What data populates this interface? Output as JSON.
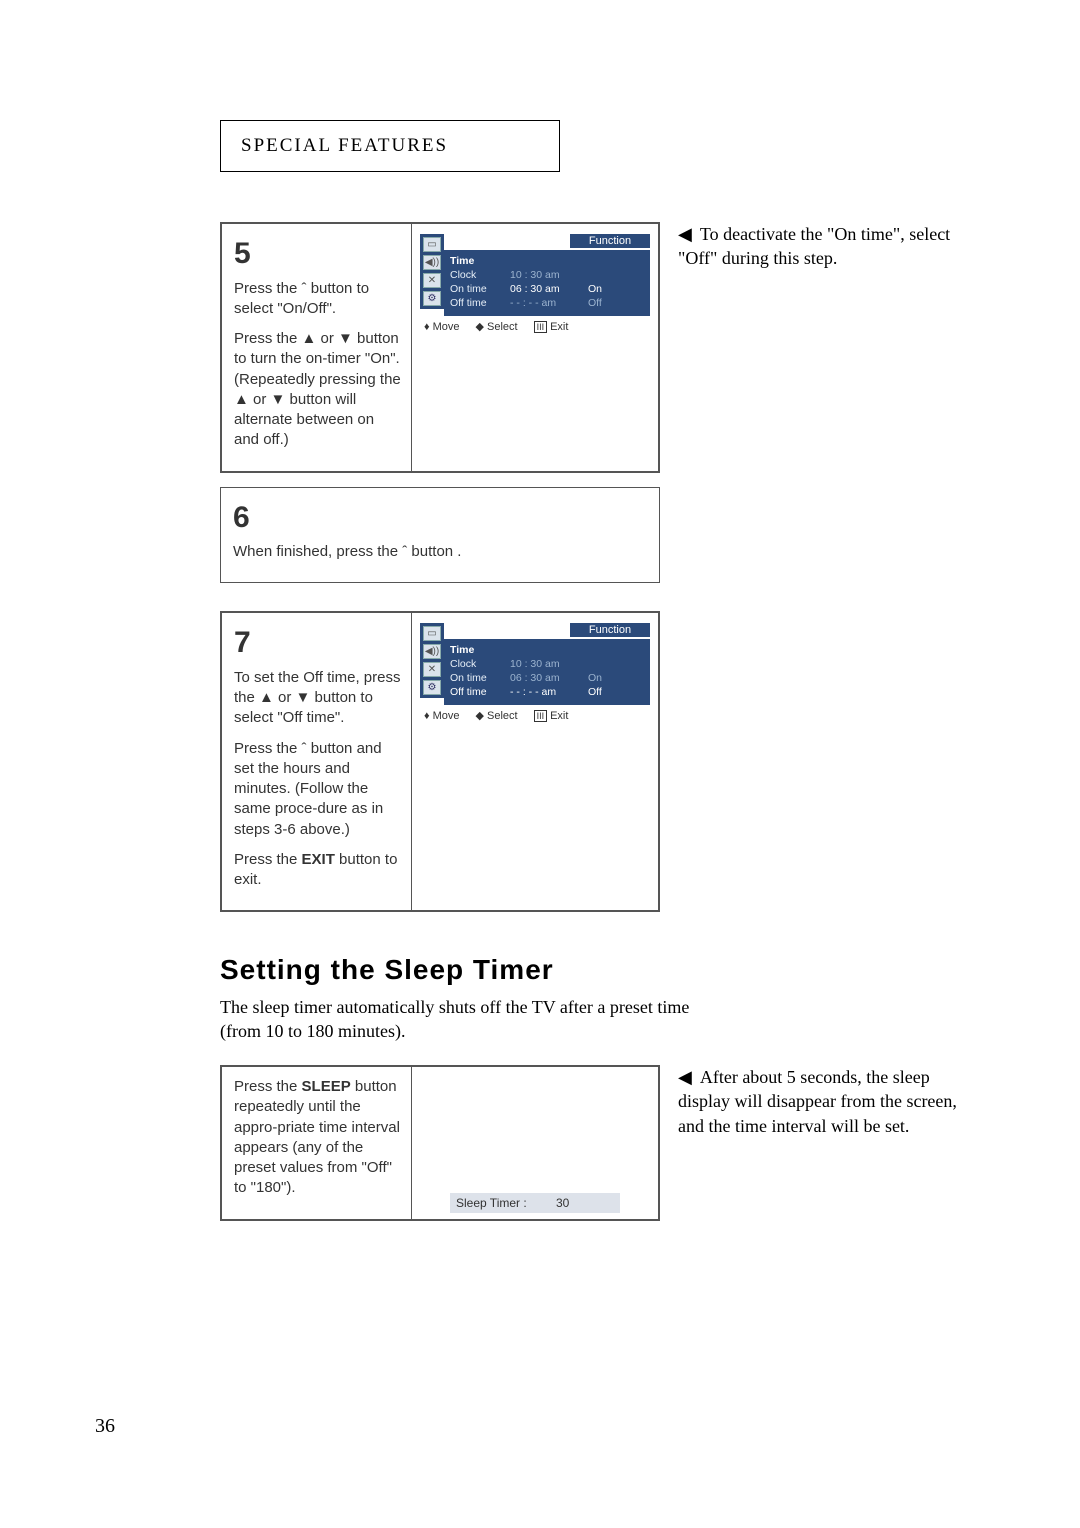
{
  "header": {
    "title": "SPECIAL FEATURES"
  },
  "note5": {
    "text": "To deactivate the \"On time\", select \"Off\" during this step."
  },
  "noteSleep": {
    "text": "After about 5 seconds, the sleep display will disappear from the screen, and the time interval will be set."
  },
  "step5": {
    "num": "5",
    "p1a": "Press the ",
    "p1b": " button to select \"On/Off\".",
    "p2a": "Press the ▲ or ▼ button to turn the on-timer \"On\". (Repeatedly pressing the ▲ or ▼ button will alternate between on and off.)"
  },
  "step6": {
    "num": "6",
    "p1": "When finished, press the ˆ button ."
  },
  "step7": {
    "num": "7",
    "p1": "To set the Off time, press the ▲ or ▼ button to select \"Off time\".",
    "p2": "Press the ˆ button and set the hours and minutes. (Follow the same proce-dure as in steps 3-6 above.)",
    "p3a": "Press the ",
    "p3b": "EXIT",
    "p3c": " button to exit."
  },
  "osd": {
    "fn": "Function",
    "title": "Time",
    "moveLabel": "Move",
    "selectLabel": "Select",
    "exitLabel": "Exit",
    "rows5": {
      "clock_k": "Clock",
      "clock_v": "10 : 30 am",
      "on_k": "On time",
      "on_v": "06 : 30 am",
      "on_s": "On",
      "off_k": "Off time",
      "off_v": "- - : - - am",
      "off_s": "Off"
    },
    "rows7": {
      "clock_k": "Clock",
      "clock_v": "10 : 30 am",
      "on_k": "On time",
      "on_v": "06 : 30 am",
      "on_s": "On",
      "off_k": "Off time",
      "off_v": "- - : - - am",
      "off_s": "Off"
    }
  },
  "sleep": {
    "heading": "Setting the Sleep Timer",
    "intro": "The sleep timer automatically shuts off the TV after a preset time (from 10 to 180 minutes).",
    "stepA": "Press the ",
    "stepB": "SLEEP",
    "stepC": " button repeatedly until the appro-priate time interval appears (any of the preset values from \"Off\" to \"180\").",
    "bar_label": "Sleep Timer   :",
    "bar_value": "30"
  },
  "pageNumber": "36"
}
